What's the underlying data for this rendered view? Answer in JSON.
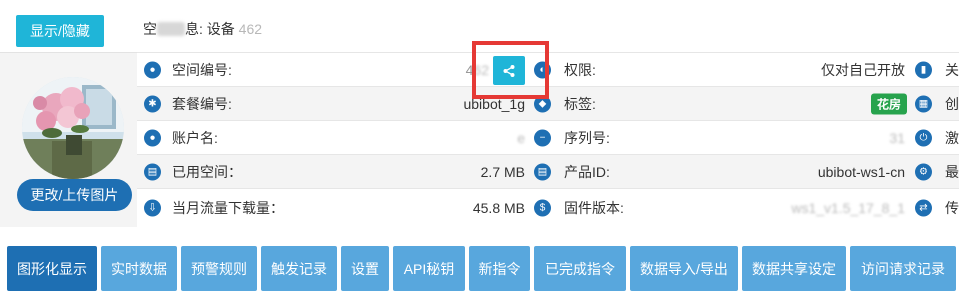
{
  "header": {
    "toggle_label": "显示/隐藏",
    "title_prefix": "空",
    "title_mid": "息: 设备 ",
    "title_suffix": "4",
    "title_faded": "62"
  },
  "profile": {
    "upload_label": "更改/上传图片"
  },
  "rows": [
    {
      "c1_label": "空间编号:",
      "c1_value": "4",
      "c1_value_faded": "62",
      "c2_label": "权限:",
      "c2_value": "仅对自己开放",
      "c3_label": "关"
    },
    {
      "c1_label": "套餐编号:",
      "c1_value": "ubibot_1g",
      "c2_label": "标签:",
      "c2_badge": "花房",
      "c3_label": "创"
    },
    {
      "c1_label": "账户名:",
      "c1_value": "e",
      "c2_label": "序列号:",
      "c2_value": "31",
      "c3_label": "激"
    },
    {
      "c1_label": "已用空间：",
      "c1_value": "2.7 MB",
      "c2_label": "产品ID:",
      "c2_value": "ubibot-ws1-cn",
      "c3_label": "最"
    },
    {
      "c1_label": "当月流量下载量：",
      "c1_value": "45.8 MB",
      "c2_label": "固件版本:",
      "c2_value": "ws1_v1.5_17_8_1",
      "c3_label": "传"
    }
  ],
  "tabs": [
    "图形化显示",
    "实时数据",
    "预警规则",
    "触发记录",
    "设置",
    "API秘钥",
    "新指令",
    "已完成指令",
    "数据导入/导出",
    "数据共享设定",
    "访问请求记录"
  ],
  "colors": {
    "accent": "#1fb5d8",
    "primary": "#1e6fb3",
    "tab": "#58a7dd",
    "badge": "#27a34d",
    "highlight": "#e53935"
  }
}
